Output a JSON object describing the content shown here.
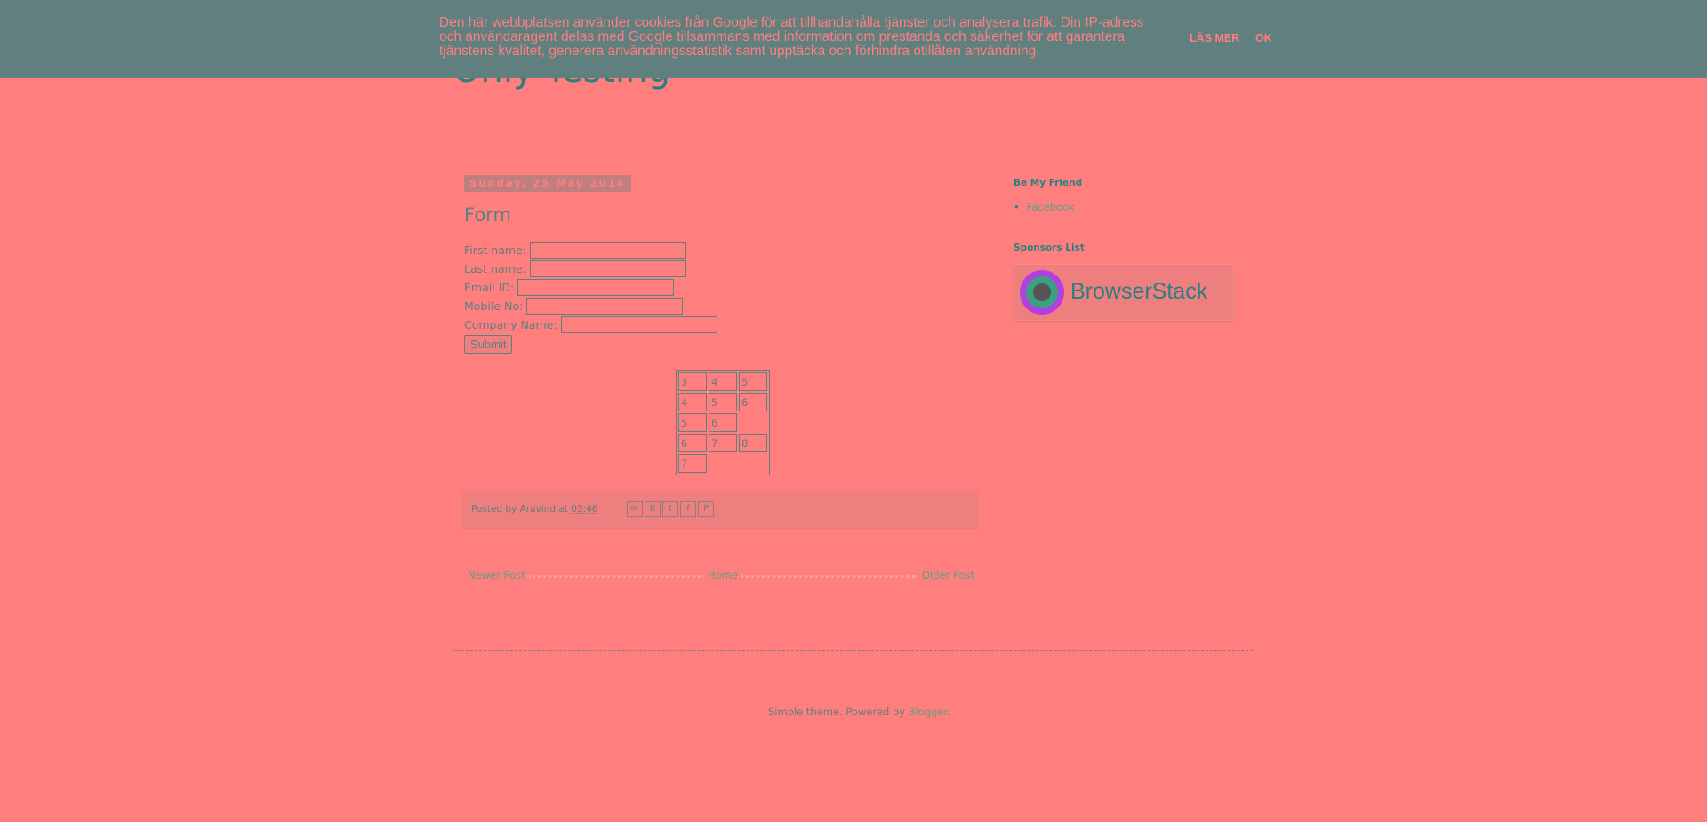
{
  "cookie_bar": {
    "text": "Den här webbplatsen använder cookies från Google för att tillhandahålla tjänster och analysera trafik. Din IP-adress och användaragent delas med Google tillsammans med information om prestanda och säkerhet för att garantera tjänstens kvalitet, generera användningsstatistik samt upptäcka och förhindra otillåten användning.",
    "learn_more": "LÄS MER",
    "ok": "OK"
  },
  "blog": {
    "title": "Only Testing"
  },
  "post": {
    "date": "Sunday, 25 May 2014",
    "title": "Form",
    "fields": [
      {
        "label": "First name:"
      },
      {
        "label": "Last name:"
      },
      {
        "label": "Email ID:"
      },
      {
        "label": "Mobile No:"
      },
      {
        "label": "Company Name:"
      }
    ],
    "submit_label": "Submit",
    "table": [
      [
        "3",
        "4",
        "5"
      ],
      [
        "4",
        "5",
        "6"
      ],
      [
        "5",
        "6",
        ""
      ],
      [
        "6",
        "7",
        "8"
      ],
      [
        "7",
        "",
        ""
      ]
    ],
    "meta": {
      "posted_by": "Posted by",
      "author": "Aravind",
      "at": "at",
      "time": "03:46"
    },
    "share_icons": [
      "email-icon",
      "blogthis-icon",
      "twitter-icon",
      "facebook-icon",
      "pinterest-icon"
    ]
  },
  "pager": {
    "newer": "Newer Post",
    "home": "Home",
    "older": "Older Post"
  },
  "sidebar": {
    "friend_title": "Be My Friend",
    "friend_link": "Facebook",
    "sponsors_title": "Sponsors List",
    "sponsor_name": "BrowserStack"
  },
  "footer": {
    "prefix": "Simple theme. Powered by",
    "link": "Blogger",
    "suffix": "."
  }
}
